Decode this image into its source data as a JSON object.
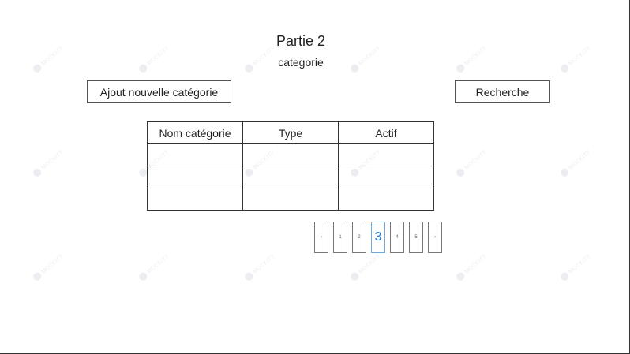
{
  "header": {
    "title": "Partie 2",
    "subtitle": "categorie"
  },
  "toolbar": {
    "add_label": "Ajout nouvelle catégorie",
    "search_label": "Recherche"
  },
  "table": {
    "columns": [
      "Nom catégorie",
      "Type",
      "Actif"
    ],
    "rows": [
      [
        "",
        "",
        ""
      ],
      [
        "",
        "",
        ""
      ],
      [
        "",
        "",
        ""
      ]
    ]
  },
  "pagination": {
    "prev": "‹",
    "next": "›",
    "pages": [
      "1",
      "2",
      "3",
      "4",
      "5"
    ],
    "current": "3"
  },
  "watermark": {
    "text": "MOCKITT",
    "icon": "mockitt-logo-icon"
  },
  "colors": {
    "active_page": "#1e7fd1",
    "active_border": "#6fa8dc"
  }
}
